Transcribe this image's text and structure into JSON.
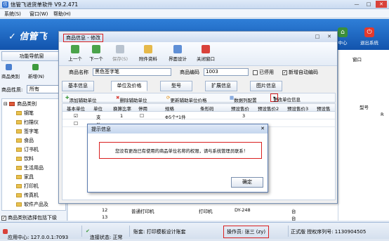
{
  "app": {
    "title": "信管飞进货单软件 V9.2.471",
    "window_controls": [
      "—",
      "□",
      "✕"
    ],
    "menu": [
      "系统(S)",
      "窗口(W)",
      "帮助(H)"
    ],
    "logo": "信管飞",
    "top_buttons": [
      {
        "label": "中心",
        "icon": "home-icon"
      },
      {
        "label": "退出系统",
        "icon": "power-icon"
      }
    ]
  },
  "left": {
    "tab": "功能导航窗",
    "tools": [
      "商品类别",
      "新增(N)"
    ],
    "filter_label": "商品性质:",
    "filter_value": "所有",
    "tree_root": "商品类别",
    "tree_items": [
      "钢笔",
      "扫描仪",
      "签字笔",
      "食品",
      "订书机",
      "饮料",
      "生活用品",
      "家具",
      "打印机",
      "传真机",
      "软件产品及"
    ],
    "bottom_check": "商品类别选择包括下级"
  },
  "dialog": {
    "title": "商品信息 - 修改",
    "toolbar": [
      "上一个",
      "下一个",
      "保存(S)",
      "附件资料",
      "界面设计",
      "关闭窗口"
    ],
    "name_label": "商品名称",
    "name_value": "黑色签字笔",
    "code_label": "商品编码",
    "code_value": "1003",
    "disabled_label": "已停用",
    "auto_code_label": "新增自动编码",
    "tabs": [
      "基本信息",
      "单位及价格",
      "型号",
      "扩展信息",
      "图片信息"
    ],
    "subtools": [
      "添加辅助单位",
      "删除辅助单位",
      "更新辅助单位价格",
      "数据列配置",
      "更改单位信息"
    ],
    "grid_headers": [
      "基本单位",
      "单位",
      "换算比率",
      "停用",
      "规格",
      "条形码",
      "预设售价",
      "预设售价2",
      "预设售价3",
      "预设售"
    ],
    "grid_rows": [
      {
        "base": "☑",
        "unit": "支",
        "ratio": "1",
        "disabled": "☐",
        "spec": "Φ5个*1件",
        "barcode": "",
        "price": "3"
      },
      {
        "base": "☐",
        "unit": "件",
        "ratio": "",
        "disabled": "",
        "spec": "",
        "barcode": "",
        "price": ""
      }
    ]
  },
  "message": {
    "title": "提示信息",
    "text": "您没有更改已有使用的商品单位名称的权限，请与系统管理员联系！",
    "ok": "确定"
  },
  "background_table": {
    "rows": [
      {
        "no": "12",
        "name": "普通打印机",
        "cat": "打印机",
        "code": "DY-248",
        "mark": "台"
      },
      {
        "no": "13",
        "name": "",
        "cat": "",
        "code": "",
        "mark": "台"
      }
    ],
    "right_header": "型号",
    "right_labels": [
      "窗口",
      "R"
    ]
  },
  "status": {
    "center": "应用中心: 127.0.0.1:7093",
    "connection": "连接状态: 正常",
    "account": "账套: 打印模板设计账套",
    "operator": "操作员: 张三 (zy)",
    "edition": "正式版 授权序列号: 1130904505"
  },
  "colors": {
    "banner": "#1b63c4",
    "highlight": "#d92020",
    "accent": "#2d6fcf"
  }
}
